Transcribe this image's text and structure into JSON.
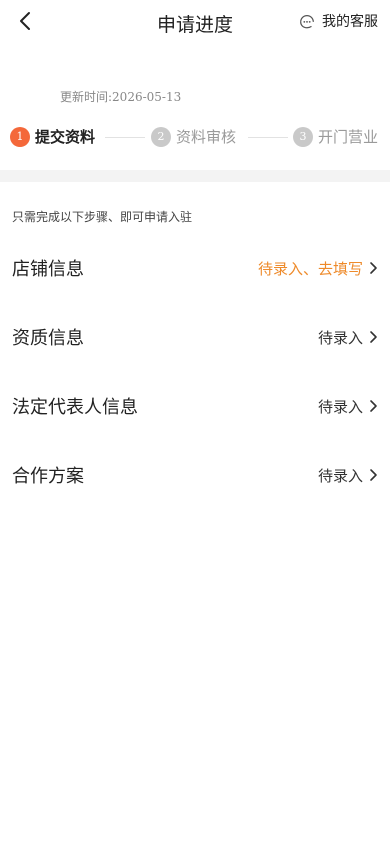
{
  "header": {
    "title": "申请进度",
    "service_label": "我的客服"
  },
  "update_time": "更新时间:2026-05-13",
  "steps": [
    {
      "num": "1",
      "label": "提交资料"
    },
    {
      "num": "2",
      "label": "资料审核"
    },
    {
      "num": "3",
      "label": "开门营业"
    }
  ],
  "hint": "只需完成以下步骤、即可申请入驻",
  "items": [
    {
      "label": "店铺信息",
      "status": "待录入、去填写"
    },
    {
      "label": "资质信息",
      "status": "待录入"
    },
    {
      "label": "法定代表人信息",
      "status": "待录入"
    },
    {
      "label": "合作方案",
      "status": "待录入"
    }
  ],
  "colors": {
    "accent": "#f4683a",
    "status_highlight": "#ee8a2a",
    "inactive_step": "#c9c9c9"
  }
}
